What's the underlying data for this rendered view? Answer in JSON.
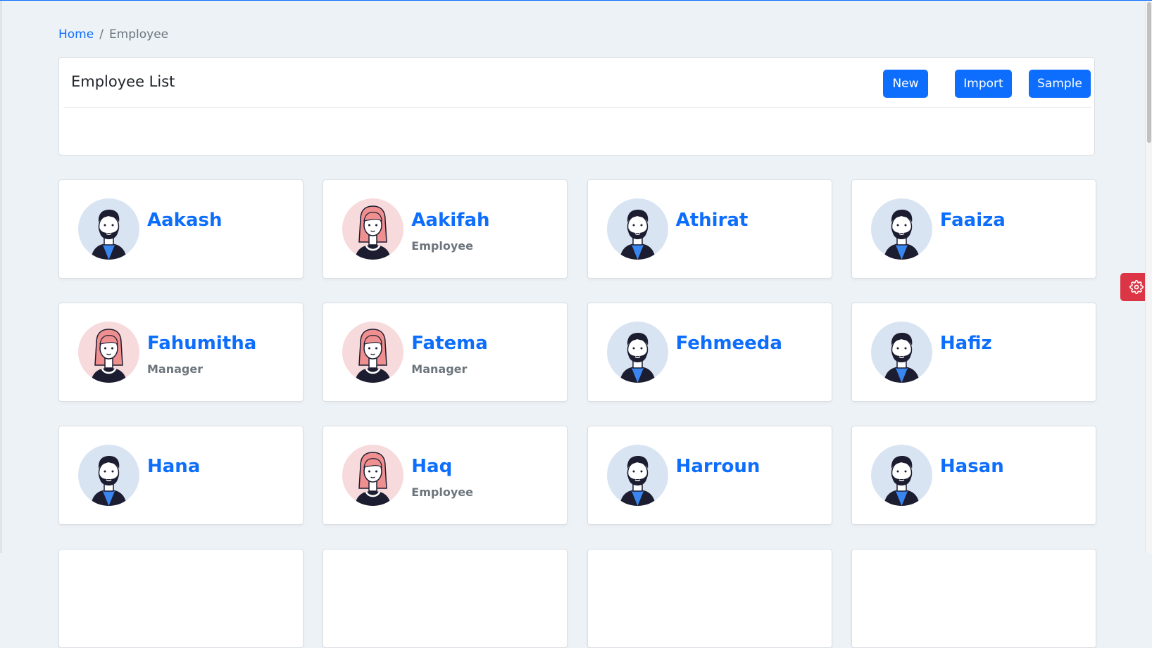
{
  "breadcrumb": {
    "home": "Home",
    "separator": "/",
    "current": "Employee"
  },
  "list_header": {
    "title": "Employee List",
    "new_label": "New",
    "import_label": "Import",
    "sample_label": "Sample"
  },
  "employees": [
    {
      "name": "Aakash",
      "role": "",
      "avatar": "male-avatar"
    },
    {
      "name": "Aakifah",
      "role": "Employee",
      "avatar": "female-avatar"
    },
    {
      "name": "Athirat",
      "role": "",
      "avatar": "male-avatar"
    },
    {
      "name": "Faaiza",
      "role": "",
      "avatar": "male-avatar"
    },
    {
      "name": "Fahumitha",
      "role": "Manager",
      "avatar": "female-avatar"
    },
    {
      "name": "Fatema",
      "role": "Manager",
      "avatar": "female-avatar"
    },
    {
      "name": "Fehmeeda",
      "role": "",
      "avatar": "male-avatar"
    },
    {
      "name": "Hafiz",
      "role": "",
      "avatar": "male-avatar"
    },
    {
      "name": "Hana",
      "role": "",
      "avatar": "male-avatar"
    },
    {
      "name": "Haq",
      "role": "Employee",
      "avatar": "female-avatar"
    },
    {
      "name": "Harroun",
      "role": "",
      "avatar": "male-avatar"
    },
    {
      "name": "Hasan",
      "role": "",
      "avatar": "male-avatar"
    },
    {
      "name": "",
      "role": "",
      "avatar": ""
    },
    {
      "name": "",
      "role": "",
      "avatar": ""
    },
    {
      "name": "",
      "role": "",
      "avatar": ""
    },
    {
      "name": "",
      "role": "",
      "avatar": ""
    }
  ],
  "settings": {
    "icon": "gear-icon"
  },
  "colors": {
    "accent": "#0d6efd",
    "settings": "#dc3545",
    "male_bg": "#d9e4f3",
    "female_bg": "#f7dadc"
  }
}
